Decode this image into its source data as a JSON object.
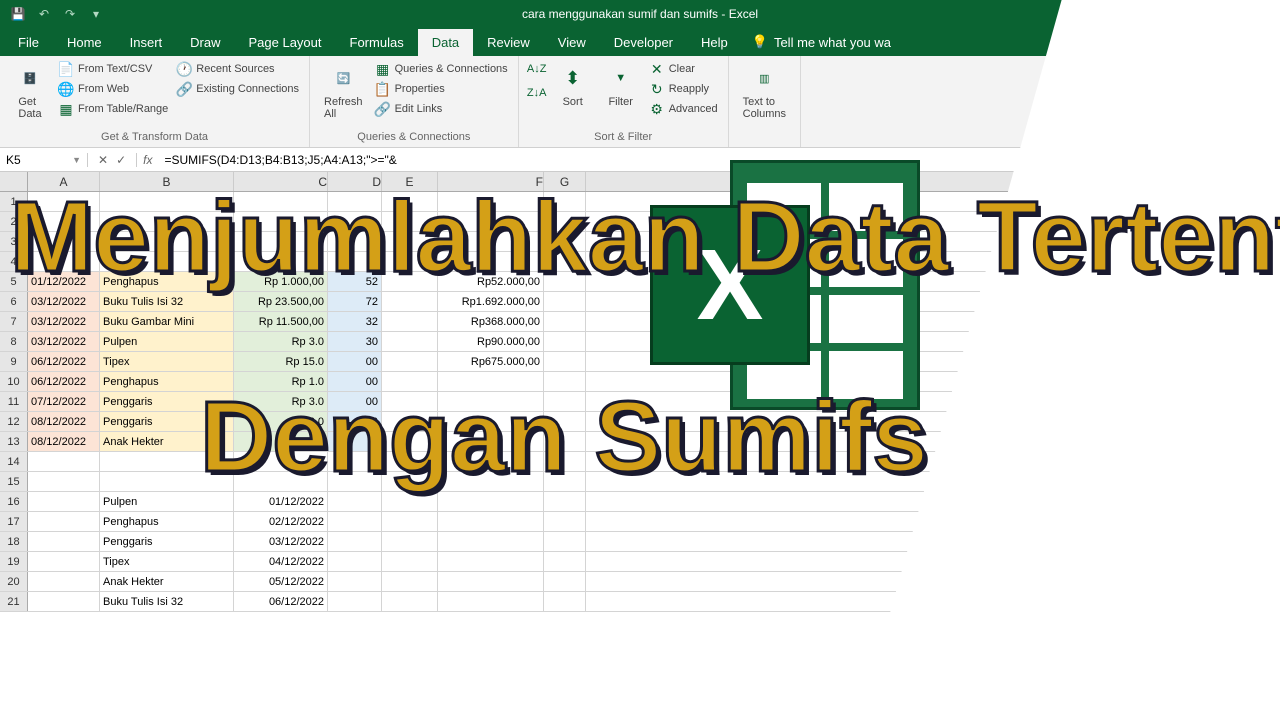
{
  "title": "cara menggunakan sumif dan sumifs  -  Excel",
  "menu": {
    "file": "File",
    "home": "Home",
    "insert": "Insert",
    "draw": "Draw",
    "page_layout": "Page Layout",
    "formulas": "Formulas",
    "data": "Data",
    "review": "Review",
    "view": "View",
    "developer": "Developer",
    "help": "Help",
    "tell_me": "Tell me what you wa"
  },
  "ribbon": {
    "get_data": "Get\nData",
    "from_text": "From Text/CSV",
    "from_web": "From Web",
    "from_table": "From Table/Range",
    "recent": "Recent Sources",
    "existing": "Existing Connections",
    "group1": "Get & Transform Data",
    "refresh": "Refresh\nAll",
    "queries": "Queries & Connections",
    "properties": "Properties",
    "edit_links": "Edit Links",
    "group2": "Queries & Connections",
    "sort": "Sort",
    "filter": "Filter",
    "clear": "Clear",
    "reapply": "Reapply",
    "advanced": "Advanced",
    "group3": "Sort & Filter",
    "text_cols": "Text to\nColumns"
  },
  "namebox": "K5",
  "formula": "=SUMIFS(D4:D13;B4:B13;J5;A4:A13;\">=\"&",
  "cols": [
    "A",
    "B",
    "C",
    "D",
    "E",
    "F",
    "G"
  ],
  "rows": [
    {
      "n": "1"
    },
    {
      "n": "2"
    },
    {
      "n": "3"
    },
    {
      "n": "4"
    },
    {
      "n": "5",
      "a": "01/12/2022",
      "b": "Penghapus",
      "c": "Rp 1.000,00",
      "d": "52",
      "f": "Rp52.000,00"
    },
    {
      "n": "6",
      "a": "03/12/2022",
      "b": "Buku Tulis Isi 32",
      "c": "Rp 23.500,00",
      "d": "72",
      "f": "Rp1.692.000,00"
    },
    {
      "n": "7",
      "a": "03/12/2022",
      "b": "Buku Gambar Mini",
      "c": "Rp 11.500,00",
      "d": "32",
      "f": "Rp368.000,00"
    },
    {
      "n": "8",
      "a": "03/12/2022",
      "b": "Pulpen",
      "c": "Rp 3.0",
      "d": "30",
      "f": "Rp90.000,00"
    },
    {
      "n": "9",
      "a": "06/12/2022",
      "b": "Tipex",
      "c": "Rp 15.0",
      "d": "00",
      "f": "Rp675.000,00"
    },
    {
      "n": "10",
      "a": "06/12/2022",
      "b": "Penghapus",
      "c": "Rp 1.0",
      "d": "00",
      "f": ""
    },
    {
      "n": "11",
      "a": "07/12/2022",
      "b": "Penggaris",
      "c": "Rp 3.0",
      "d": "00",
      "f": ""
    },
    {
      "n": "12",
      "a": "08/12/2022",
      "b": "Penggaris",
      "c": "Rp 3.0",
      "d": "00",
      "f": ""
    },
    {
      "n": "13",
      "a": "08/12/2022",
      "b": "Anak Hekter",
      "c": "Rp 2.5",
      "d": "",
      "f": ""
    },
    {
      "n": "14"
    },
    {
      "n": "15"
    },
    {
      "n": "16",
      "b": "Pulpen",
      "c": "01/12/2022"
    },
    {
      "n": "17",
      "b": "Penghapus",
      "c": "02/12/2022"
    },
    {
      "n": "18",
      "b": "Penggaris",
      "c": "03/12/2022"
    },
    {
      "n": "19",
      "b": "Tipex",
      "c": "04/12/2022"
    },
    {
      "n": "20",
      "b": "Anak Hekter",
      "c": "05/12/2022"
    },
    {
      "n": "21",
      "b": "Buku Tulis Isi 32",
      "c": "06/12/2022"
    }
  ],
  "overlay": {
    "line1": "Menjumlahkan Data Tertentu",
    "line2": "Dengan  Sumifs"
  }
}
